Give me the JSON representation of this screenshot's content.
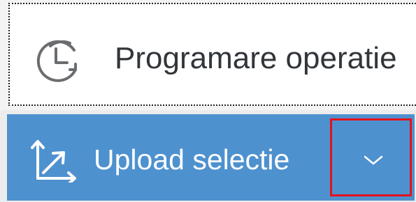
{
  "menu": {
    "items": [
      {
        "label": "Programare operatie",
        "icon": "clock-rotate-icon"
      }
    ]
  },
  "split_button": {
    "label": "Upload selectie",
    "icon": "upload-arrows-icon",
    "dropdown_icon": "chevron-down-icon",
    "color": "#4e91cf",
    "highlight_color": "#e3121b"
  }
}
